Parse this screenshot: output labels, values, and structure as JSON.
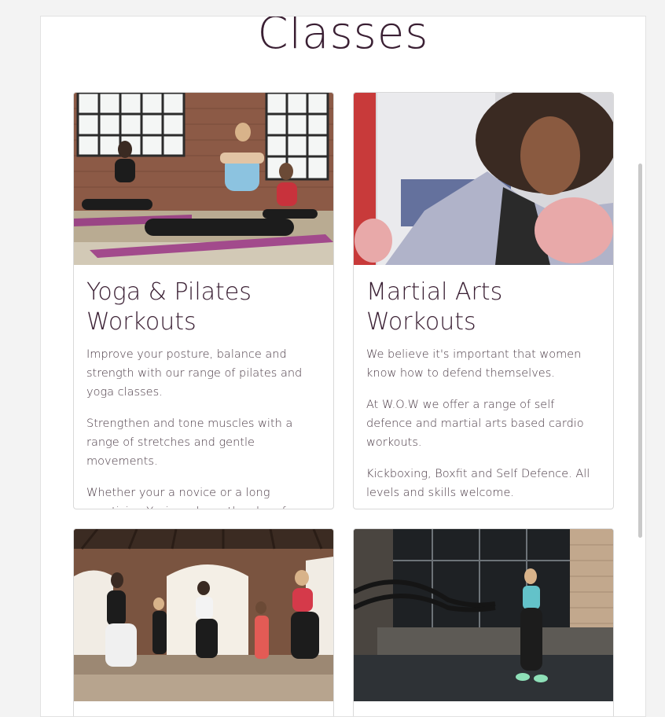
{
  "section": {
    "title": "Classes"
  },
  "cards": [
    {
      "title": "Yoga & Pilates Workouts",
      "image": "yoga-pilates-photo",
      "paragraphs": [
        "Improve your posture, balance and strength with our range of pilates and yoga classes.",
        "Strengthen and tone muscles with a range of stretches and gentle movements.",
        "Whether your a novice or a long practicing Yogi, we have the class for you."
      ]
    },
    {
      "title": "Martial Arts Workouts",
      "image": "boxing-photo",
      "paragraphs": [
        "We believe it's important that women know how to defend themselves.",
        "At W.O.W we offer a range of self defence and martial arts based cardio workouts.",
        "Kickboxing, Boxfit and Self Defence. All levels and skills welcome."
      ]
    },
    {
      "title": "",
      "image": "group-squat-class-photo",
      "paragraphs": []
    },
    {
      "title": "",
      "image": "battle-ropes-photo",
      "paragraphs": []
    }
  ],
  "colors": {
    "title": "#3a1f33",
    "text": "#4a3a45",
    "background": "#f3f3f3"
  }
}
